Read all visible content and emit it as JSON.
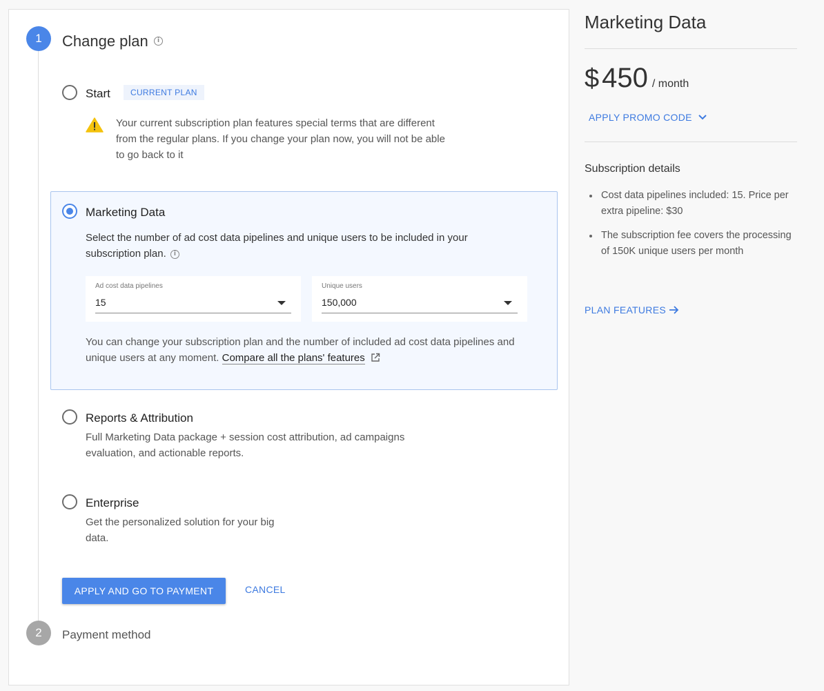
{
  "steps": {
    "step1": {
      "number": "1",
      "title": "Change plan"
    },
    "step2": {
      "number": "2",
      "title": "Payment method"
    }
  },
  "plans": {
    "start": {
      "name": "Start",
      "badge": "CURRENT PLAN",
      "warning": "Your current subscription plan features special terms that are different from the regular plans. If you change your plan now, you will not be able to go back to it"
    },
    "marketing_data": {
      "name": "Marketing Data",
      "description": "Select the number of ad cost data pipelines and unique users to be included in your subscription plan.",
      "pipelines_label": "Ad cost data pipelines",
      "pipelines_value": "15",
      "users_label": "Unique users",
      "users_value": "150,000",
      "note": "You can change your subscription plan and the number of included ad cost data pipelines and unique users at any moment.",
      "compare_link": "Compare all the plans' features"
    },
    "reports": {
      "name": "Reports & Attribution",
      "description": "Full Marketing Data package + session cost attribution, ad campaigns evaluation, and actionable reports."
    },
    "enterprise": {
      "name": "Enterprise",
      "description": "Get the personalized solution for your big data."
    }
  },
  "actions": {
    "apply_label": "APPLY AND GO TO PAYMENT",
    "cancel_label": "CANCEL"
  },
  "sidebar": {
    "title": "Marketing Data",
    "currency": "$",
    "amount": "450",
    "period": "/ month",
    "promo_label": "APPLY PROMO CODE",
    "subscription_title": "Subscription details",
    "details": [
      "Cost data pipelines included: 15. Price per extra pipeline: $30",
      "The subscription fee covers the processing of 150K unique users per month"
    ],
    "features_label": "PLAN FEATURES"
  },
  "colors": {
    "accent": "#4a86e8",
    "warning": "#f4c20d"
  }
}
